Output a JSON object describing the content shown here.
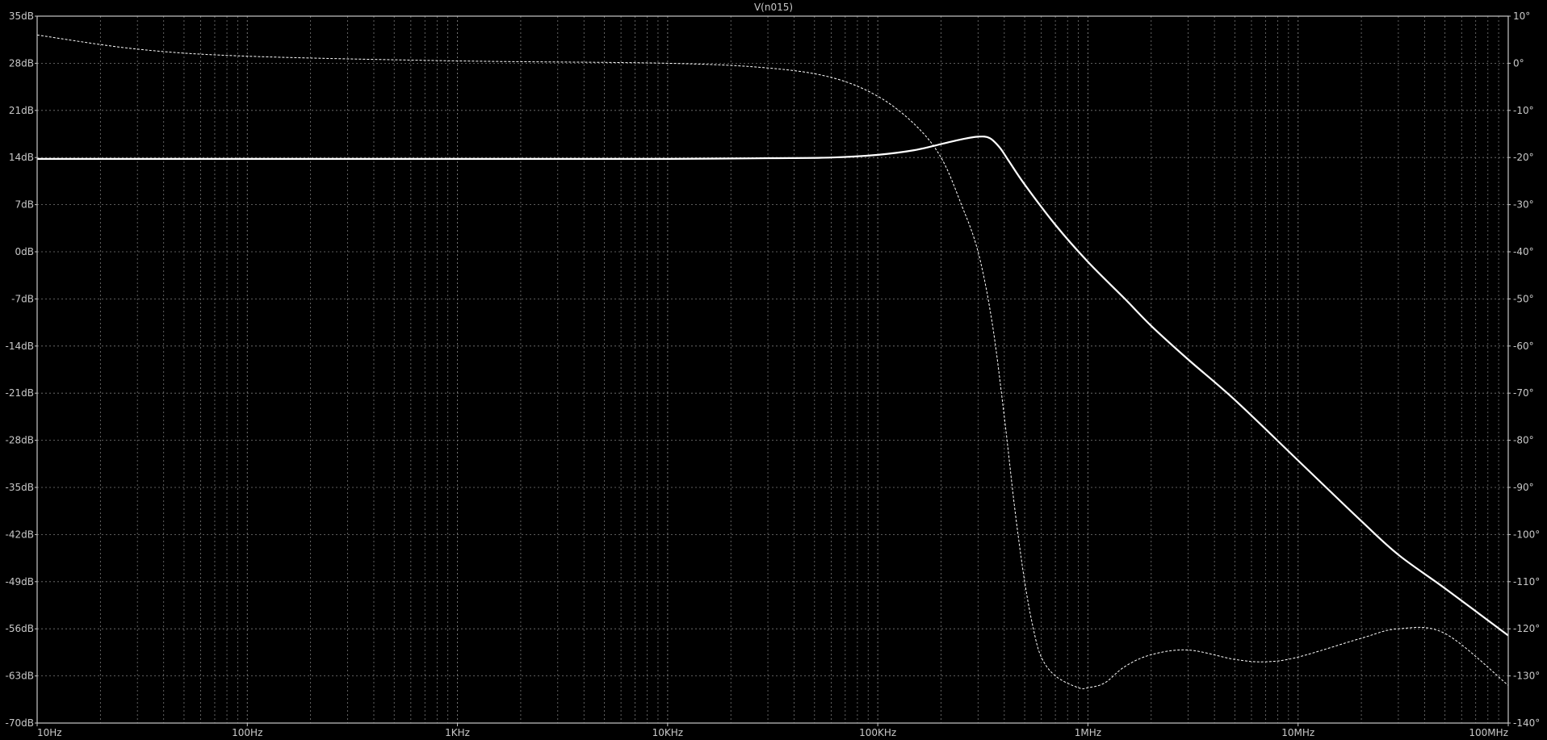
{
  "chart_data": {
    "type": "line",
    "title": "V(n015)",
    "x_scale": "log",
    "xlim": [
      10,
      100000000
    ],
    "ylim_left": [
      -70,
      35
    ],
    "ylim_right": [
      -140,
      10
    ],
    "grid": true,
    "x_ticks": [
      {
        "value": 10,
        "label": "10Hz"
      },
      {
        "value": 100,
        "label": "100Hz"
      },
      {
        "value": 1000,
        "label": "1KHz"
      },
      {
        "value": 10000,
        "label": "10KHz"
      },
      {
        "value": 100000,
        "label": "100KHz"
      },
      {
        "value": 1000000,
        "label": "1MHz"
      },
      {
        "value": 10000000,
        "label": "10MHz"
      },
      {
        "value": 100000000,
        "label": "100MHz"
      }
    ],
    "y_left_ticks": [
      {
        "value": 35,
        "label": "35dB"
      },
      {
        "value": 28,
        "label": "28dB"
      },
      {
        "value": 21,
        "label": "21dB"
      },
      {
        "value": 14,
        "label": "14dB"
      },
      {
        "value": 7,
        "label": "7dB"
      },
      {
        "value": 0,
        "label": "0dB"
      },
      {
        "value": -7,
        "label": "-7dB"
      },
      {
        "value": -14,
        "label": "-14dB"
      },
      {
        "value": -21,
        "label": "-21dB"
      },
      {
        "value": -28,
        "label": "-28dB"
      },
      {
        "value": -35,
        "label": "-35dB"
      },
      {
        "value": -42,
        "label": "-42dB"
      },
      {
        "value": -49,
        "label": "-49dB"
      },
      {
        "value": -56,
        "label": "-56dB"
      },
      {
        "value": -63,
        "label": "-63dB"
      },
      {
        "value": -70,
        "label": "-70dB"
      }
    ],
    "y_right_ticks": [
      {
        "value": 10,
        "label": "10°"
      },
      {
        "value": 0,
        "label": "0°"
      },
      {
        "value": -10,
        "label": "-10°"
      },
      {
        "value": -20,
        "label": "-20°"
      },
      {
        "value": -30,
        "label": "-30°"
      },
      {
        "value": -40,
        "label": "-40°"
      },
      {
        "value": -50,
        "label": "-50°"
      },
      {
        "value": -60,
        "label": "-60°"
      },
      {
        "value": -70,
        "label": "-70°"
      },
      {
        "value": -80,
        "label": "-80°"
      },
      {
        "value": -90,
        "label": "-90°"
      },
      {
        "value": -100,
        "label": "-100°"
      },
      {
        "value": -110,
        "label": "-110°"
      },
      {
        "value": -120,
        "label": "-120°"
      },
      {
        "value": -130,
        "label": "-130°"
      },
      {
        "value": -140,
        "label": "-140°"
      }
    ],
    "series": [
      {
        "axis": "left",
        "style": "solid",
        "color": "#ffffff",
        "x": [
          10,
          1000,
          10000,
          30000,
          60000,
          100000,
          150000,
          200000,
          250000,
          300000,
          340000,
          380000,
          420000,
          500000,
          700000,
          1000000,
          1500000,
          2000000,
          3000000,
          5000000,
          10000000,
          20000000,
          30000000,
          50000000,
          100000000
        ],
        "y": [
          13.8,
          13.8,
          13.8,
          13.9,
          14.0,
          14.4,
          15.1,
          16.0,
          16.7,
          17.1,
          16.9,
          15.5,
          13.5,
          10.0,
          4.0,
          -1.5,
          -7.0,
          -11.0,
          -16.0,
          -22.0,
          -31.0,
          -40.0,
          -45.0,
          -50.0,
          -57.0
        ]
      },
      {
        "axis": "right",
        "style": "dashed",
        "color": "#ffffff",
        "x": [
          10,
          30,
          100,
          1000,
          10000,
          30000,
          60000,
          100000,
          150000,
          200000,
          250000,
          300000,
          350000,
          400000,
          450000,
          500000,
          550000,
          600000,
          700000,
          900000,
          1000000,
          1200000,
          1500000,
          2000000,
          3000000,
          5000000,
          7000000,
          10000000,
          20000000,
          30000000,
          50000000,
          100000000
        ],
        "y": [
          6.0,
          3.0,
          1.5,
          0.5,
          0.0,
          -1.0,
          -3.0,
          -7.0,
          -13.0,
          -20.0,
          -30.0,
          -40.0,
          -55.0,
          -75.0,
          -95.0,
          -110.0,
          -120.0,
          -126.0,
          -130.0,
          -132.5,
          -132.5,
          -131.5,
          -128.0,
          -125.5,
          -124.5,
          -126.5,
          -127.0,
          -126.0,
          -122.0,
          -120.0,
          -121.0,
          -132.0
        ]
      }
    ]
  }
}
